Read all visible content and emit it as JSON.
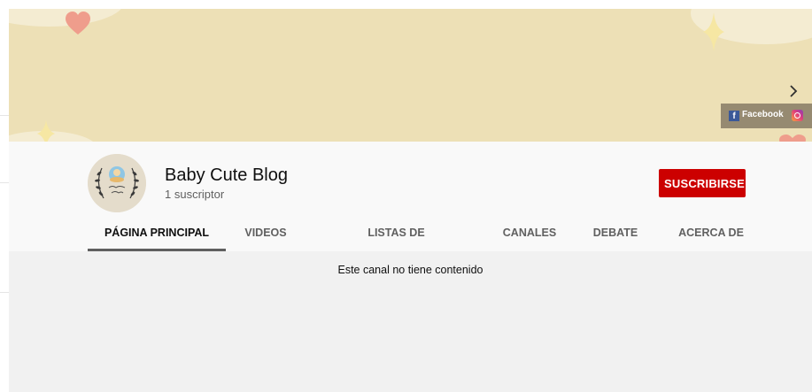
{
  "banner": {
    "links": {
      "facebook_label": "Facebook",
      "facebook_icon": "facebook-icon",
      "instagram_icon": "instagram-icon"
    },
    "colors": {
      "background": "#ede0b6",
      "heart": "#ef9d8c",
      "sparkle": "#f6e7a3"
    }
  },
  "channel": {
    "name": "Baby Cute Blog",
    "subscribers": "1 suscriptor",
    "subscribe_label": "SUSCRIBIRSE",
    "avatar_icon": "channel-avatar-wreath"
  },
  "tabs": [
    {
      "label": "PÁGINA PRINCIPAL",
      "active": true
    },
    {
      "label": "VIDEOS",
      "active": false
    },
    {
      "label": "LISTAS DE REPRODUCCIÓN",
      "active": false
    },
    {
      "label": "CANALES",
      "active": false
    },
    {
      "label": "DEBATE",
      "active": false
    },
    {
      "label": "ACERCA DE",
      "active": false
    }
  ],
  "tabs_more_icon": "chevron-right-icon",
  "content": {
    "empty_message": "Este canal no tiene contenido"
  },
  "colors": {
    "subscribe": "#cc0000",
    "header_bg": "#f9f9f9",
    "content_bg": "#f1f1f1"
  }
}
